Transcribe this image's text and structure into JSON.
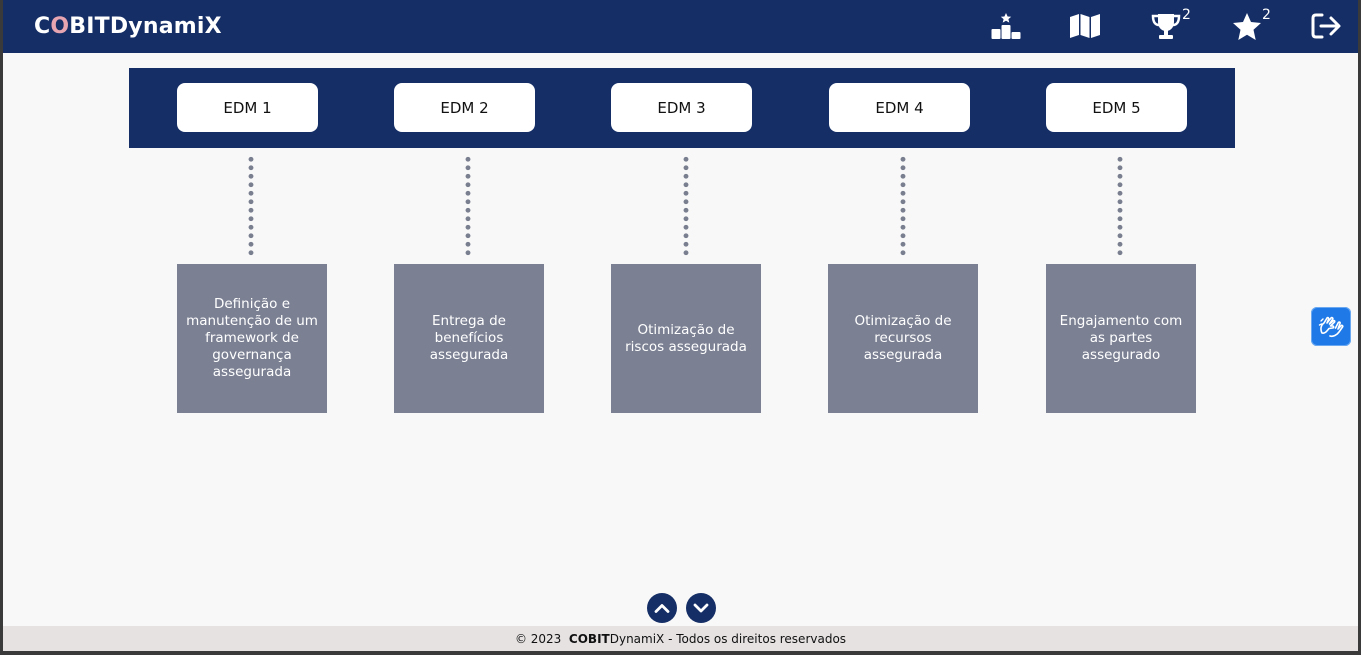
{
  "app": {
    "logo_c": "C",
    "logo_o": "O",
    "logo_rest": "BITDynamiX"
  },
  "nav": {
    "trophy_count": "2",
    "star_count": "2",
    "icons": [
      "ranking-icon",
      "map-icon",
      "trophy-icon",
      "star-icon",
      "logout-icon"
    ]
  },
  "edm": [
    {
      "label": "EDM 1",
      "description": "Definição e manutenção de um framework de governança assegurada"
    },
    {
      "label": "EDM 2",
      "description": "Entrega de benefícios assegurada"
    },
    {
      "label": "EDM 3",
      "description": "Otimização de riscos assegurada"
    },
    {
      "label": "EDM 4",
      "description": "Otimização de recursos assegurada"
    },
    {
      "label": "EDM 5",
      "description": "Engajamento com as partes assegurado"
    }
  ],
  "footer": {
    "copyright": "© 2023  ",
    "brand": "COBIT",
    "brand_rest": "DynamiX - Todos os direitos reservados"
  },
  "colors": {
    "primary": "#152e66",
    "card": "#7b8093",
    "accent": "#1f7ae8",
    "logo_o": "#e7a4b1"
  }
}
